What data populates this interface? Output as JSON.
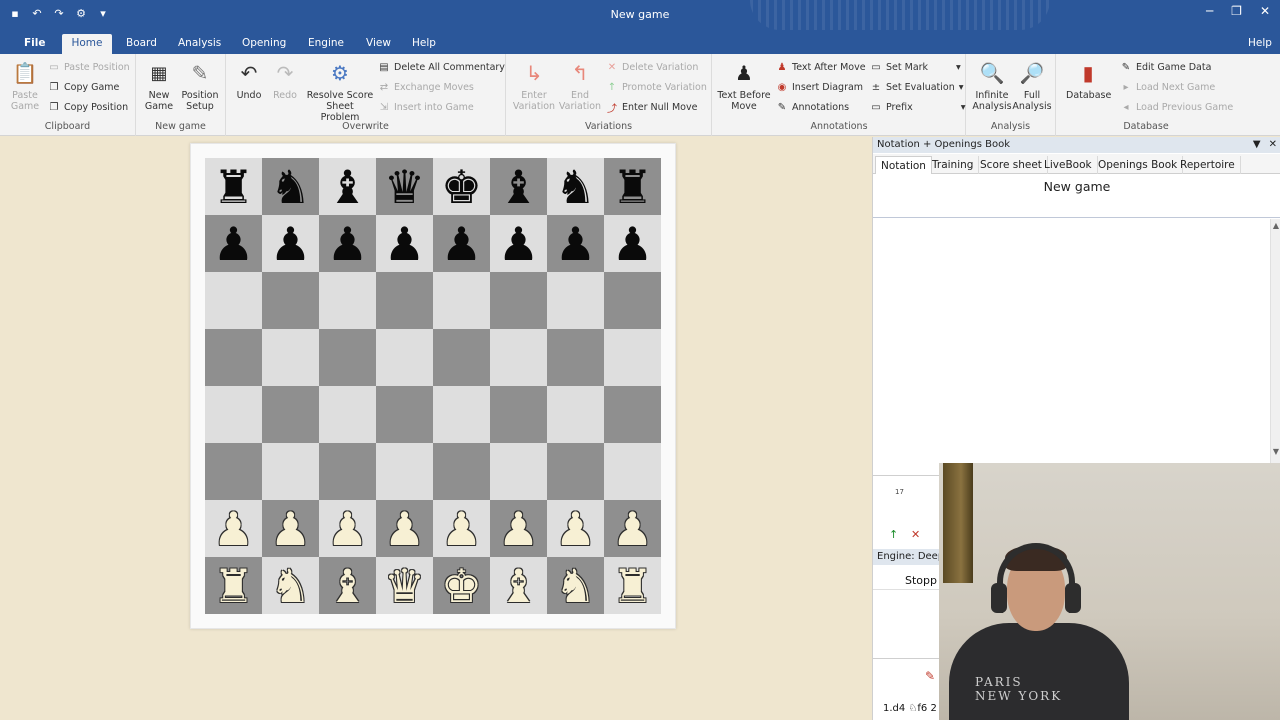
{
  "app": {
    "title": "New game",
    "quick_access_icons": [
      "save-icon",
      "undo-icon",
      "redo-icon",
      "settings-gear-icon",
      "customize-icon"
    ],
    "window_buttons": [
      "─",
      "❐",
      "✕"
    ]
  },
  "ribbon_tabs": [
    "File",
    "Home",
    "Board",
    "Analysis",
    "Opening",
    "Engine",
    "View",
    "Help"
  ],
  "ribbon_help": "Help",
  "groups": {
    "clipboard": {
      "label": "Clipboard",
      "paste_game": "Paste\nGame",
      "paste_position": "Paste Position",
      "copy_game": "Copy Game",
      "copy_position": "Copy Position"
    },
    "new_game": {
      "label": "New game",
      "new_game": "New\nGame",
      "position_setup": "Position\nSetup"
    },
    "overwrite": {
      "label": "Overwrite",
      "undo": "Undo",
      "redo": "Redo",
      "resolve": "Resolve Score\nSheet Problem",
      "delete_all_commentary": "Delete All Commentary",
      "exchange_moves": "Exchange Moves",
      "insert_into_game": "Insert into Game"
    },
    "variations": {
      "label": "Variations",
      "enter_variation": "Enter\nVariation",
      "end_variation": "End\nVariation",
      "delete_variation": "Delete Variation",
      "promote_variation": "Promote Variation",
      "enter_null_move": "Enter Null Move"
    },
    "annotations": {
      "label": "Annotations",
      "text_before_move": "Text Before\nMove",
      "text_after_move": "Text After Move",
      "insert_diagram": "Insert Diagram",
      "annotations": "Annotations",
      "set_mark": "Set Mark",
      "set_evaluation": "Set Evaluation",
      "prefix": "Prefix"
    },
    "analysis": {
      "label": "Analysis",
      "infinite": "Infinite\nAnalysis",
      "full": "Full\nAnalysis"
    },
    "database": {
      "label": "Database",
      "database": "Database",
      "edit_game_data": "Edit Game Data",
      "load_next_game": "Load Next Game",
      "load_previous_game": "Load Previous Game"
    }
  },
  "board": {
    "ranks": [
      [
        "♜",
        "♞",
        "♝",
        "♛",
        "♚",
        "♝",
        "♞",
        "♜"
      ],
      [
        "♟",
        "♟",
        "♟",
        "♟",
        "♟",
        "♟",
        "♟",
        "♟"
      ],
      [
        "",
        "",
        "",
        "",
        "",
        "",
        "",
        ""
      ],
      [
        "",
        "",
        "",
        "",
        "",
        "",
        "",
        ""
      ],
      [
        "",
        "",
        "",
        "",
        "",
        "",
        "",
        ""
      ],
      [
        "",
        "",
        "",
        "",
        "",
        "",
        "",
        ""
      ],
      [
        "♟",
        "♟",
        "♟",
        "♟",
        "♟",
        "♟",
        "♟",
        "♟"
      ],
      [
        "♜",
        "♞",
        "♝",
        "♛",
        "♚",
        "♝",
        "♞",
        "♜"
      ]
    ],
    "colors": {
      "light": "#dedede",
      "dark": "#8f8f8f"
    }
  },
  "panel": {
    "header": "Notation + Openings Book",
    "tabs": [
      "Notation",
      "Training",
      "Score sheet",
      "LiveBook",
      "Openings Book",
      "Repertoire"
    ],
    "game_title": "New game",
    "mini_number": "17",
    "engine_header": "Engine: Deep",
    "engine_status": "Stopp",
    "engine_line": "1.d4 ♘f6 2"
  },
  "webcam": {
    "shirt_text_1": "PARIS",
    "shirt_text_2": "NEW YORK"
  }
}
